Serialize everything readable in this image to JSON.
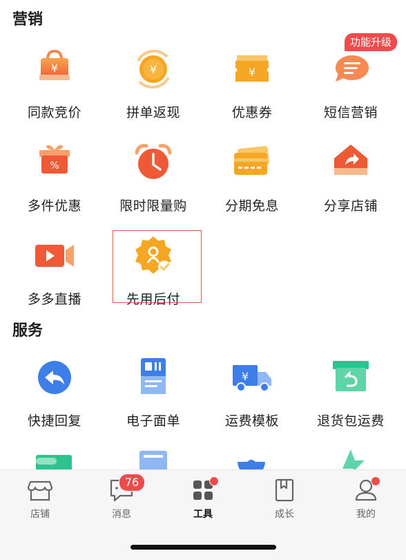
{
  "sections": {
    "marketing": {
      "title": "营销",
      "items": [
        {
          "label": "同款竞价",
          "icon": "shopping-bag-yen-icon"
        },
        {
          "label": "拼单返现",
          "icon": "yen-coin-cashback-icon"
        },
        {
          "label": "优惠券",
          "icon": "coupon-icon"
        },
        {
          "label": "短信营销",
          "icon": "sms-chat-icon",
          "badge": "功能升级"
        },
        {
          "label": "多件优惠",
          "icon": "gift-box-percent-icon"
        },
        {
          "label": "限时限量购",
          "icon": "alarm-clock-icon"
        },
        {
          "label": "分期免息",
          "icon": "credit-card-icon"
        },
        {
          "label": "分享店铺",
          "icon": "share-store-icon"
        },
        {
          "label": "多多直播",
          "icon": "live-video-icon"
        },
        {
          "label": "先用后付",
          "icon": "pay-later-badge-icon"
        }
      ]
    },
    "service": {
      "title": "服务",
      "items": [
        {
          "label": "快捷回复",
          "icon": "quick-reply-icon"
        },
        {
          "label": "电子面单",
          "icon": "e-waybill-icon"
        },
        {
          "label": "运费模板",
          "icon": "freight-truck-icon"
        },
        {
          "label": "退货包运费",
          "icon": "return-box-icon"
        }
      ]
    }
  },
  "tabbar": {
    "tabs": [
      {
        "label": "店铺",
        "icon": "store-icon"
      },
      {
        "label": "消息",
        "icon": "message-icon",
        "badge": "76"
      },
      {
        "label": "工具",
        "icon": "tools-grid-icon",
        "active": true
      },
      {
        "label": "成长",
        "icon": "growth-book-icon"
      },
      {
        "label": "我的",
        "icon": "profile-icon"
      }
    ]
  },
  "colors": {
    "orange": "#f2783c",
    "yellow": "#f5a623",
    "blue": "#3d7ee8",
    "green": "#2ec28e",
    "badge_red": "#ee4c4c"
  }
}
